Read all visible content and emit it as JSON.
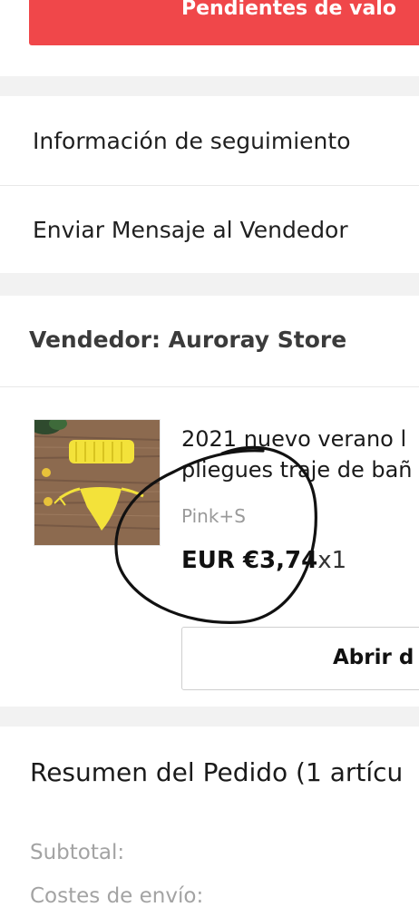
{
  "top_button": {
    "label": "Pendientes de valo"
  },
  "actions": {
    "tracking_label": "Información de seguimiento",
    "message_label": "Enviar Mensaje al Vendedor"
  },
  "seller": {
    "label": "Vendedor: Auroray Store"
  },
  "product": {
    "title_line1": "2021 nuevo verano l",
    "title_line2": "pliegues traje de bañ",
    "variant": "Pink+S",
    "price": "EUR €3,74",
    "quantity": "x1",
    "open_button_label": "Abrir d"
  },
  "summary": {
    "title": "Resumen del Pedido (1 artícu",
    "subtotal_label": "Subtotal:",
    "shipping_label": "Costes de envío:"
  },
  "colors": {
    "accent_red": "#f0474a",
    "section_gap": "#f2f2f2",
    "muted_text": "#a3a3a3"
  }
}
